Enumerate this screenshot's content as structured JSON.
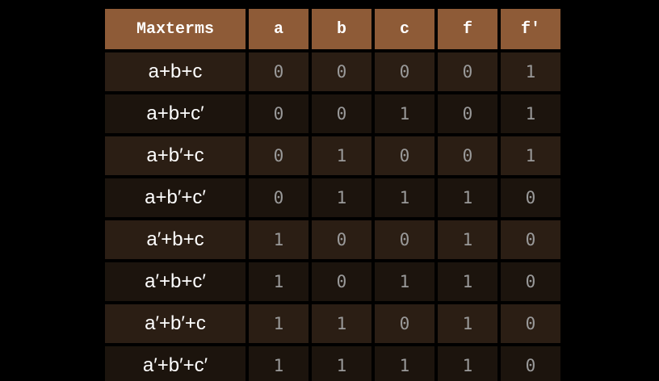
{
  "table": {
    "headers": [
      "Maxterms",
      "a",
      "b",
      "c",
      "f",
      "f′"
    ],
    "rows": [
      {
        "term": "a+b+c",
        "a": "0",
        "b": "0",
        "c": "0",
        "f": "0",
        "fp": "1"
      },
      {
        "term": "a+b+c′",
        "a": "0",
        "b": "0",
        "c": "1",
        "f": "0",
        "fp": "1"
      },
      {
        "term": "a+b′+c",
        "a": "0",
        "b": "1",
        "c": "0",
        "f": "0",
        "fp": "1"
      },
      {
        "term": "a+b′+c′",
        "a": "0",
        "b": "1",
        "c": "1",
        "f": "1",
        "fp": "0"
      },
      {
        "term": "a′+b+c",
        "a": "1",
        "b": "0",
        "c": "0",
        "f": "1",
        "fp": "0"
      },
      {
        "term": "a′+b+c′",
        "a": "1",
        "b": "0",
        "c": "1",
        "f": "1",
        "fp": "0"
      },
      {
        "term": "a′+b′+c",
        "a": "1",
        "b": "1",
        "c": "0",
        "f": "1",
        "fp": "0"
      },
      {
        "term": "a′+b′+c′",
        "a": "1",
        "b": "1",
        "c": "1",
        "f": "1",
        "fp": "0"
      }
    ]
  },
  "colors": {
    "header_bg": "#8e5b37",
    "row_odd_bg": "#2b1e14",
    "row_even_bg": "#1c140d",
    "page_bg": "#000000"
  }
}
